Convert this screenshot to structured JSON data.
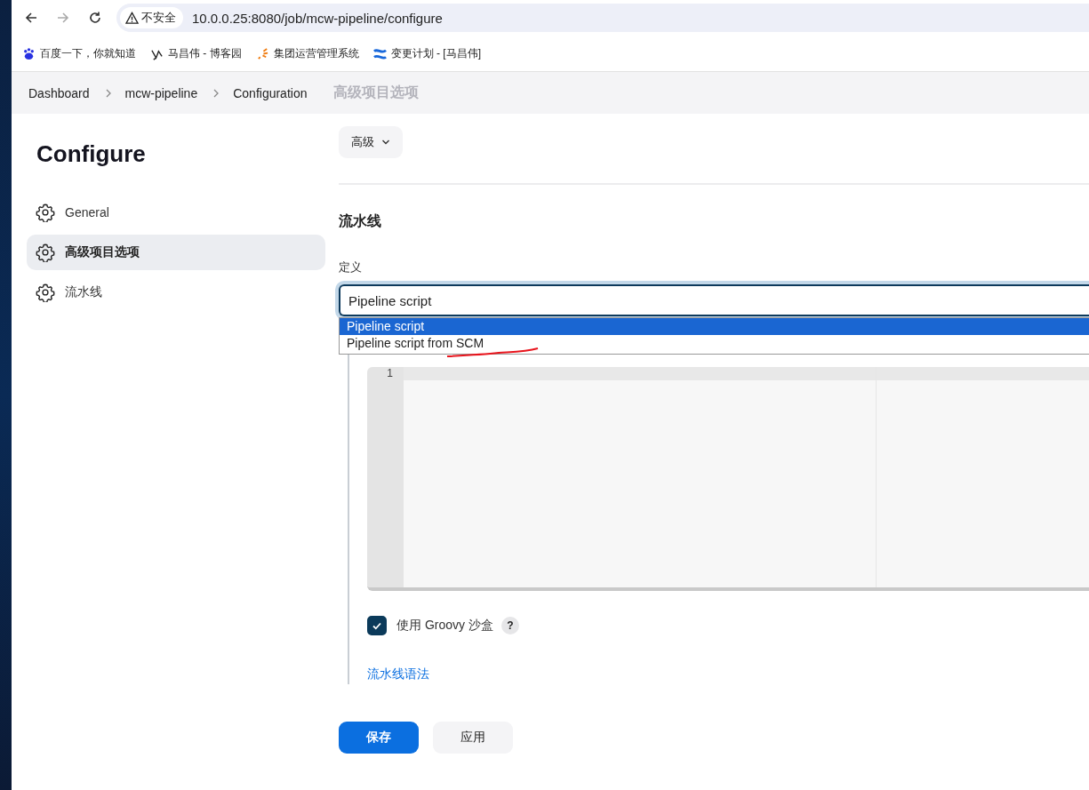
{
  "browser": {
    "security_label": "不安全",
    "url": "10.0.0.25:8080/job/mcw-pipeline/configure",
    "bookmarks": [
      {
        "label": "百度一下，你就知道"
      },
      {
        "label": "马昌伟 - 博客园"
      },
      {
        "label": "集团运营管理系统"
      },
      {
        "label": "变更计划 - [马昌伟]"
      }
    ]
  },
  "breadcrumb": [
    "Dashboard",
    "mcw-pipeline",
    "Configuration"
  ],
  "sticky_section_title": "高级项目选项",
  "sidebar": {
    "title": "Configure",
    "items": [
      {
        "label": "General",
        "selected": false
      },
      {
        "label": "高级项目选项",
        "selected": true
      },
      {
        "label": "流水线",
        "selected": false
      }
    ]
  },
  "advanced_button": "高级",
  "section": {
    "title": "流水线",
    "definition_label": "定义",
    "definition_value": "Pipeline script",
    "options": [
      {
        "label": "Pipeline script",
        "selected": true
      },
      {
        "label": "Pipeline script from SCM",
        "selected": false
      }
    ],
    "editor": {
      "line_numbers": [
        "1"
      ]
    },
    "sandbox": {
      "label": "使用 Groovy 沙盒",
      "checked": true,
      "help": "?"
    },
    "syntax_link": "流水线语法"
  },
  "buttons": [
    {
      "label": "保存",
      "kind": "primary"
    },
    {
      "label": "应用",
      "kind": "secondary"
    }
  ]
}
